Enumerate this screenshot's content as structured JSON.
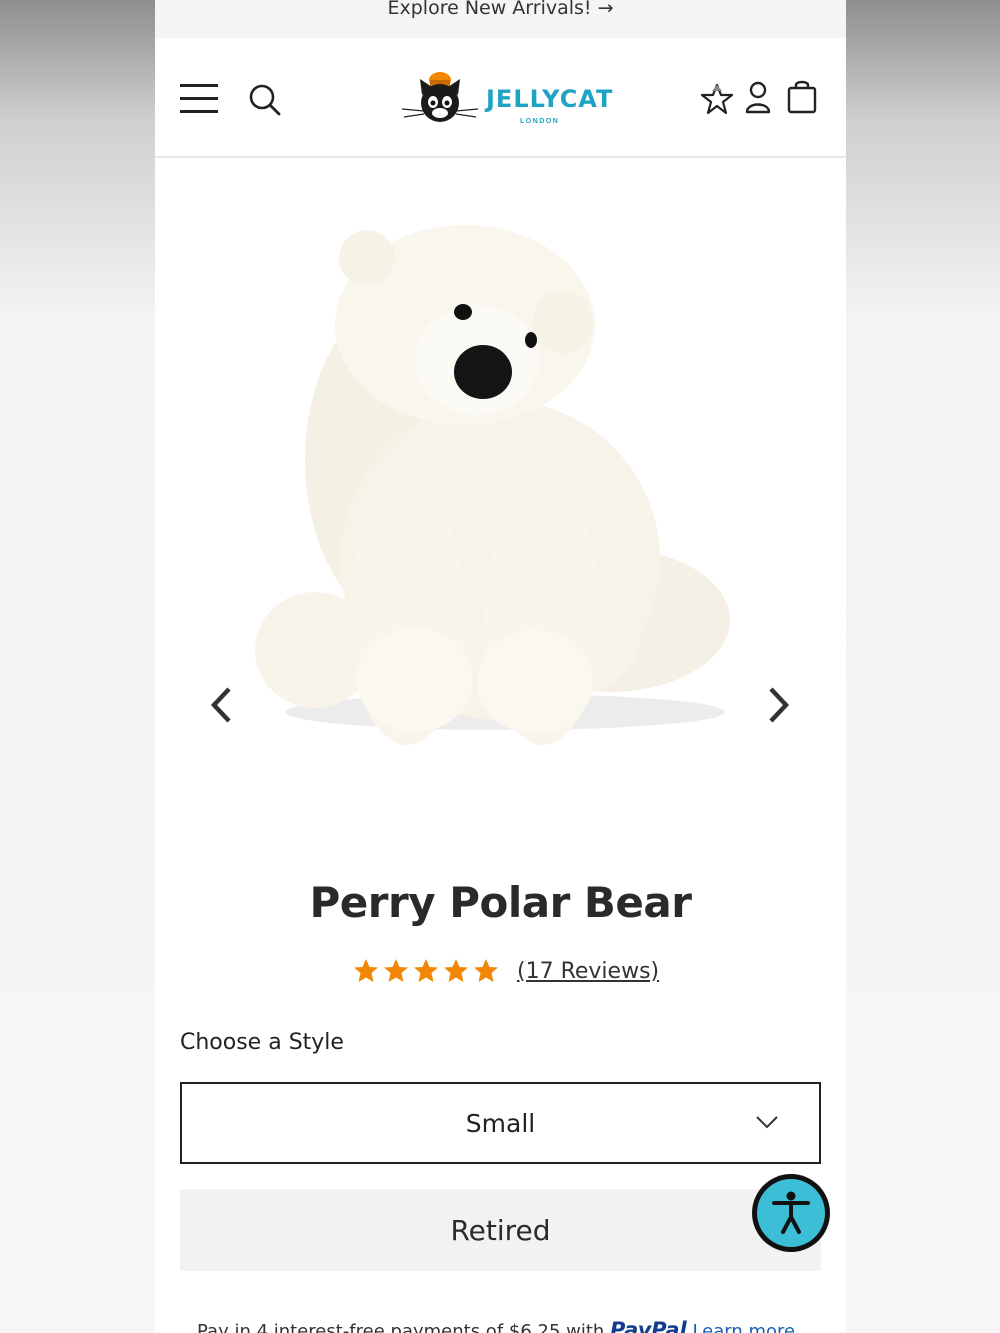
{
  "promo": {
    "text": "Explore New Arrivals! →"
  },
  "header": {
    "logo_text": "JELLYCAT",
    "logo_sub": "LONDON",
    "icons": [
      "menu-icon",
      "search-icon",
      "wishlist-star-icon",
      "account-icon",
      "shopping-bag-icon"
    ]
  },
  "product": {
    "title": "Perry Polar Bear",
    "rating": 5,
    "reviews_label": "(17 Reviews)",
    "style_label": "Choose a Style",
    "selected_style": "Small",
    "status_button": "Retired",
    "paypal_prefix": "Pay in 4 interest-free payments of $6.25 with",
    "paypal_brand": "PayPal",
    "learn_more": "Learn more"
  },
  "colors": {
    "star": "#f28705",
    "logo_blue": "#1fa3c4",
    "accessibility_button": "#3cbfd6",
    "paypal_blue": "#123c8c"
  }
}
